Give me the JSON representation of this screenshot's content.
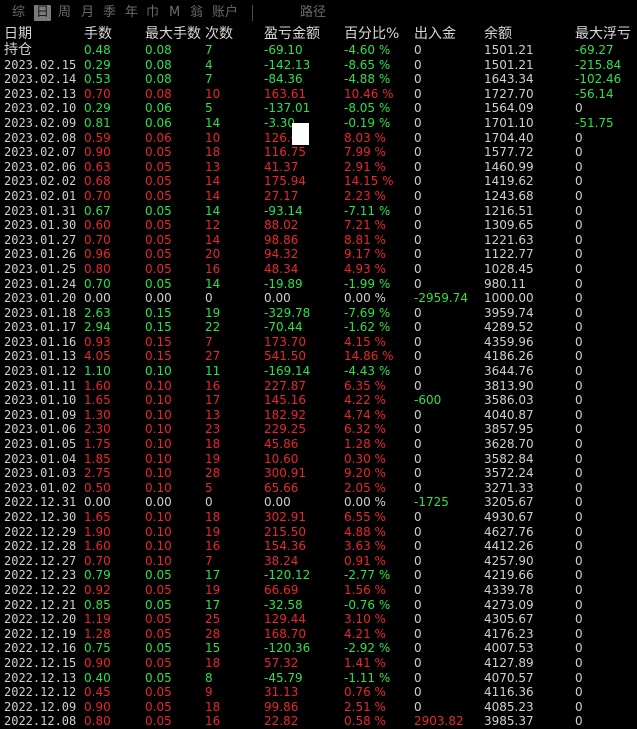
{
  "tabs": [
    {
      "label": "综",
      "active": false
    },
    {
      "label": "日",
      "active": true
    },
    {
      "label": "周",
      "active": false
    },
    {
      "label": "月",
      "active": false
    },
    {
      "label": "季",
      "active": false
    },
    {
      "label": "年",
      "active": false
    },
    {
      "label": "巾",
      "active": false
    },
    {
      "label": "M",
      "active": false
    },
    {
      "label": "翁",
      "active": false
    },
    {
      "label": "账户",
      "active": false
    },
    {
      "label": "路径",
      "active": false
    }
  ],
  "columns": [
    "日期",
    "手数",
    "最大手数",
    "次数",
    "盈亏金额",
    "百分比%",
    "出入金",
    "余额",
    "最大浮亏"
  ],
  "holding": {
    "label": "持仓",
    "lots": "0.48",
    "max_lots": "0.08",
    "count": "7",
    "pnl": "-69.10",
    "pct": "-4.60 %",
    "io": "0",
    "balance": "1501.21",
    "max_dd": "-69.27"
  },
  "rows": [
    {
      "date": "2023.02.15",
      "lots": "0.29",
      "max_lots": "0.08",
      "count": "4",
      "pnl": "-142.13",
      "pct": "-8.65 %",
      "io": "0",
      "balance": "1501.21",
      "max_dd": "-215.84",
      "color": "green"
    },
    {
      "date": "2023.02.14",
      "lots": "0.53",
      "max_lots": "0.08",
      "count": "7",
      "pnl": "-84.36",
      "pct": "-4.88 %",
      "io": "0",
      "balance": "1643.34",
      "max_dd": "-102.46",
      "color": "green"
    },
    {
      "date": "2023.02.13",
      "lots": "0.70",
      "max_lots": "0.08",
      "count": "10",
      "pnl": "163.61",
      "pct": "10.46 %",
      "io": "0",
      "balance": "1727.70",
      "max_dd": "-56.14",
      "color": "red"
    },
    {
      "date": "2023.02.10",
      "lots": "0.29",
      "max_lots": "0.06",
      "count": "5",
      "pnl": "-137.01",
      "pct": "-8.05 %",
      "io": "0",
      "balance": "1564.09",
      "max_dd": "0",
      "color": "green"
    },
    {
      "date": "2023.02.09",
      "lots": "0.81",
      "max_lots": "0.06",
      "count": "14",
      "pnl": "-3.30",
      "pct": "-0.19 %",
      "io": "0",
      "balance": "1701.10",
      "max_dd": "-51.75",
      "color": "green"
    },
    {
      "date": "2023.02.08",
      "lots": "0.59",
      "max_lots": "0.06",
      "count": "10",
      "pnl": "126.6",
      "pct": "8.03 %",
      "io": "0",
      "balance": "1704.40",
      "max_dd": "0",
      "color": "red"
    },
    {
      "date": "2023.02.07",
      "lots": "0.90",
      "max_lots": "0.05",
      "count": "18",
      "pnl": "116.75",
      "pct": "7.99 %",
      "io": "0",
      "balance": "1577.72",
      "max_dd": "0",
      "color": "red"
    },
    {
      "date": "2023.02.06",
      "lots": "0.63",
      "max_lots": "0.05",
      "count": "13",
      "pnl": "41.37",
      "pct": "2.91 %",
      "io": "0",
      "balance": "1460.99",
      "max_dd": "0",
      "color": "red"
    },
    {
      "date": "2023.02.02",
      "lots": "0.68",
      "max_lots": "0.05",
      "count": "14",
      "pnl": "175.94",
      "pct": "14.15 %",
      "io": "0",
      "balance": "1419.62",
      "max_dd": "0",
      "color": "red"
    },
    {
      "date": "2023.02.01",
      "lots": "0.70",
      "max_lots": "0.05",
      "count": "14",
      "pnl": "27.17",
      "pct": "2.23 %",
      "io": "0",
      "balance": "1243.68",
      "max_dd": "0",
      "color": "red"
    },
    {
      "date": "2023.01.31",
      "lots": "0.67",
      "max_lots": "0.05",
      "count": "14",
      "pnl": "-93.14",
      "pct": "-7.11 %",
      "io": "0",
      "balance": "1216.51",
      "max_dd": "0",
      "color": "green"
    },
    {
      "date": "2023.01.30",
      "lots": "0.60",
      "max_lots": "0.05",
      "count": "12",
      "pnl": "88.02",
      "pct": "7.21 %",
      "io": "0",
      "balance": "1309.65",
      "max_dd": "0",
      "color": "red"
    },
    {
      "date": "2023.01.27",
      "lots": "0.70",
      "max_lots": "0.05",
      "count": "14",
      "pnl": "98.86",
      "pct": "8.81 %",
      "io": "0",
      "balance": "1221.63",
      "max_dd": "0",
      "color": "red"
    },
    {
      "date": "2023.01.26",
      "lots": "0.96",
      "max_lots": "0.05",
      "count": "20",
      "pnl": "94.32",
      "pct": "9.17 %",
      "io": "0",
      "balance": "1122.77",
      "max_dd": "0",
      "color": "red"
    },
    {
      "date": "2023.01.25",
      "lots": "0.80",
      "max_lots": "0.05",
      "count": "16",
      "pnl": "48.34",
      "pct": "4.93 %",
      "io": "0",
      "balance": "1028.45",
      "max_dd": "0",
      "color": "red"
    },
    {
      "date": "2023.01.24",
      "lots": "0.70",
      "max_lots": "0.05",
      "count": "14",
      "pnl": "-19.89",
      "pct": "-1.99 %",
      "io": "0",
      "balance": "980.11",
      "max_dd": "0",
      "color": "green"
    },
    {
      "date": "2023.01.20",
      "lots": "0.00",
      "max_lots": "0.00",
      "count": "0",
      "pnl": "0.00",
      "pct": "0.00 %",
      "io": "-2959.74",
      "balance": "1000.00",
      "max_dd": "0",
      "color": "white",
      "io_color": "green"
    },
    {
      "date": "2023.01.18",
      "lots": "2.63",
      "max_lots": "0.15",
      "count": "19",
      "pnl": "-329.78",
      "pct": "-7.69 %",
      "io": "0",
      "balance": "3959.74",
      "max_dd": "0",
      "color": "green"
    },
    {
      "date": "2023.01.17",
      "lots": "2.94",
      "max_lots": "0.15",
      "count": "22",
      "pnl": "-70.44",
      "pct": "-1.62 %",
      "io": "0",
      "balance": "4289.52",
      "max_dd": "0",
      "color": "green"
    },
    {
      "date": "2023.01.16",
      "lots": "0.93",
      "max_lots": "0.15",
      "count": "7",
      "pnl": "173.70",
      "pct": "4.15 %",
      "io": "0",
      "balance": "4359.96",
      "max_dd": "0",
      "color": "red"
    },
    {
      "date": "2023.01.13",
      "lots": "4.05",
      "max_lots": "0.15",
      "count": "27",
      "pnl": "541.50",
      "pct": "14.86 %",
      "io": "0",
      "balance": "4186.26",
      "max_dd": "0",
      "color": "red"
    },
    {
      "date": "2023.01.12",
      "lots": "1.10",
      "max_lots": "0.10",
      "count": "11",
      "pnl": "-169.14",
      "pct": "-4.43 %",
      "io": "0",
      "balance": "3644.76",
      "max_dd": "0",
      "color": "green"
    },
    {
      "date": "2023.01.11",
      "lots": "1.60",
      "max_lots": "0.10",
      "count": "16",
      "pnl": "227.87",
      "pct": "6.35 %",
      "io": "0",
      "balance": "3813.90",
      "max_dd": "0",
      "color": "red"
    },
    {
      "date": "2023.01.10",
      "lots": "1.65",
      "max_lots": "0.10",
      "count": "17",
      "pnl": "145.16",
      "pct": "4.22 %",
      "io": "-600",
      "balance": "3586.03",
      "max_dd": "0",
      "color": "red",
      "io_color": "green"
    },
    {
      "date": "2023.01.09",
      "lots": "1.30",
      "max_lots": "0.10",
      "count": "13",
      "pnl": "182.92",
      "pct": "4.74 %",
      "io": "0",
      "balance": "4040.87",
      "max_dd": "0",
      "color": "red"
    },
    {
      "date": "2023.01.06",
      "lots": "2.30",
      "max_lots": "0.10",
      "count": "23",
      "pnl": "229.25",
      "pct": "6.32 %",
      "io": "0",
      "balance": "3857.95",
      "max_dd": "0",
      "color": "red"
    },
    {
      "date": "2023.01.05",
      "lots": "1.75",
      "max_lots": "0.10",
      "count": "18",
      "pnl": "45.86",
      "pct": "1.28 %",
      "io": "0",
      "balance": "3628.70",
      "max_dd": "0",
      "color": "red"
    },
    {
      "date": "2023.01.04",
      "lots": "1.85",
      "max_lots": "0.10",
      "count": "19",
      "pnl": "10.60",
      "pct": "0.30 %",
      "io": "0",
      "balance": "3582.84",
      "max_dd": "0",
      "color": "red"
    },
    {
      "date": "2023.01.03",
      "lots": "2.75",
      "max_lots": "0.10",
      "count": "28",
      "pnl": "300.91",
      "pct": "9.20 %",
      "io": "0",
      "balance": "3572.24",
      "max_dd": "0",
      "color": "red"
    },
    {
      "date": "2023.01.02",
      "lots": "0.50",
      "max_lots": "0.10",
      "count": "5",
      "pnl": "65.66",
      "pct": "2.05 %",
      "io": "0",
      "balance": "3271.33",
      "max_dd": "0",
      "color": "red"
    },
    {
      "date": "2022.12.31",
      "lots": "0.00",
      "max_lots": "0.00",
      "count": "0",
      "pnl": "0.00",
      "pct": "0.00 %",
      "io": "-1725",
      "balance": "3205.67",
      "max_dd": "0",
      "color": "white",
      "io_color": "green"
    },
    {
      "date": "2022.12.30",
      "lots": "1.65",
      "max_lots": "0.10",
      "count": "18",
      "pnl": "302.91",
      "pct": "6.55 %",
      "io": "0",
      "balance": "4930.67",
      "max_dd": "0",
      "color": "red"
    },
    {
      "date": "2022.12.29",
      "lots": "1.90",
      "max_lots": "0.10",
      "count": "19",
      "pnl": "215.50",
      "pct": "4.88 %",
      "io": "0",
      "balance": "4627.76",
      "max_dd": "0",
      "color": "red"
    },
    {
      "date": "2022.12.28",
      "lots": "1.60",
      "max_lots": "0.10",
      "count": "16",
      "pnl": "154.36",
      "pct": "3.63 %",
      "io": "0",
      "balance": "4412.26",
      "max_dd": "0",
      "color": "red"
    },
    {
      "date": "2022.12.27",
      "lots": "0.70",
      "max_lots": "0.10",
      "count": "7",
      "pnl": "38.24",
      "pct": "0.91 %",
      "io": "0",
      "balance": "4257.90",
      "max_dd": "0",
      "color": "red"
    },
    {
      "date": "2022.12.23",
      "lots": "0.79",
      "max_lots": "0.05",
      "count": "17",
      "pnl": "-120.12",
      "pct": "-2.77 %",
      "io": "0",
      "balance": "4219.66",
      "max_dd": "0",
      "color": "green"
    },
    {
      "date": "2022.12.22",
      "lots": "0.92",
      "max_lots": "0.05",
      "count": "19",
      "pnl": "66.69",
      "pct": "1.56 %",
      "io": "0",
      "balance": "4339.78",
      "max_dd": "0",
      "color": "red"
    },
    {
      "date": "2022.12.21",
      "lots": "0.85",
      "max_lots": "0.05",
      "count": "17",
      "pnl": "-32.58",
      "pct": "-0.76 %",
      "io": "0",
      "balance": "4273.09",
      "max_dd": "0",
      "color": "green"
    },
    {
      "date": "2022.12.20",
      "lots": "1.19",
      "max_lots": "0.05",
      "count": "25",
      "pnl": "129.44",
      "pct": "3.10 %",
      "io": "0",
      "balance": "4305.67",
      "max_dd": "0",
      "color": "red"
    },
    {
      "date": "2022.12.19",
      "lots": "1.28",
      "max_lots": "0.05",
      "count": "28",
      "pnl": "168.70",
      "pct": "4.21 %",
      "io": "0",
      "balance": "4176.23",
      "max_dd": "0",
      "color": "red"
    },
    {
      "date": "2022.12.16",
      "lots": "0.75",
      "max_lots": "0.05",
      "count": "15",
      "pnl": "-120.36",
      "pct": "-2.92 %",
      "io": "0",
      "balance": "4007.53",
      "max_dd": "0",
      "color": "green"
    },
    {
      "date": "2022.12.15",
      "lots": "0.90",
      "max_lots": "0.05",
      "count": "18",
      "pnl": "57.32",
      "pct": "1.41 %",
      "io": "0",
      "balance": "4127.89",
      "max_dd": "0",
      "color": "red"
    },
    {
      "date": "2022.12.13",
      "lots": "0.40",
      "max_lots": "0.05",
      "count": "8",
      "pnl": "-45.79",
      "pct": "-1.11 %",
      "io": "0",
      "balance": "4070.57",
      "max_dd": "0",
      "color": "green"
    },
    {
      "date": "2022.12.12",
      "lots": "0.45",
      "max_lots": "0.05",
      "count": "9",
      "pnl": "31.13",
      "pct": "0.76 %",
      "io": "0",
      "balance": "4116.36",
      "max_dd": "0",
      "color": "red"
    },
    {
      "date": "2022.12.09",
      "lots": "0.90",
      "max_lots": "0.05",
      "count": "18",
      "pnl": "99.86",
      "pct": "2.51 %",
      "io": "0",
      "balance": "4085.23",
      "max_dd": "0",
      "color": "red"
    },
    {
      "date": "2022.12.08",
      "lots": "0.80",
      "max_lots": "0.05",
      "count": "16",
      "pnl": "22.82",
      "pct": "0.58 %",
      "io": "2903.82",
      "balance": "3985.37",
      "max_dd": "0",
      "color": "red",
      "io_color": "red"
    }
  ],
  "colors": {
    "positive": "#e8262e",
    "negative": "#2ee04a",
    "neutral": "#d0d0d0",
    "background": "#000000"
  }
}
